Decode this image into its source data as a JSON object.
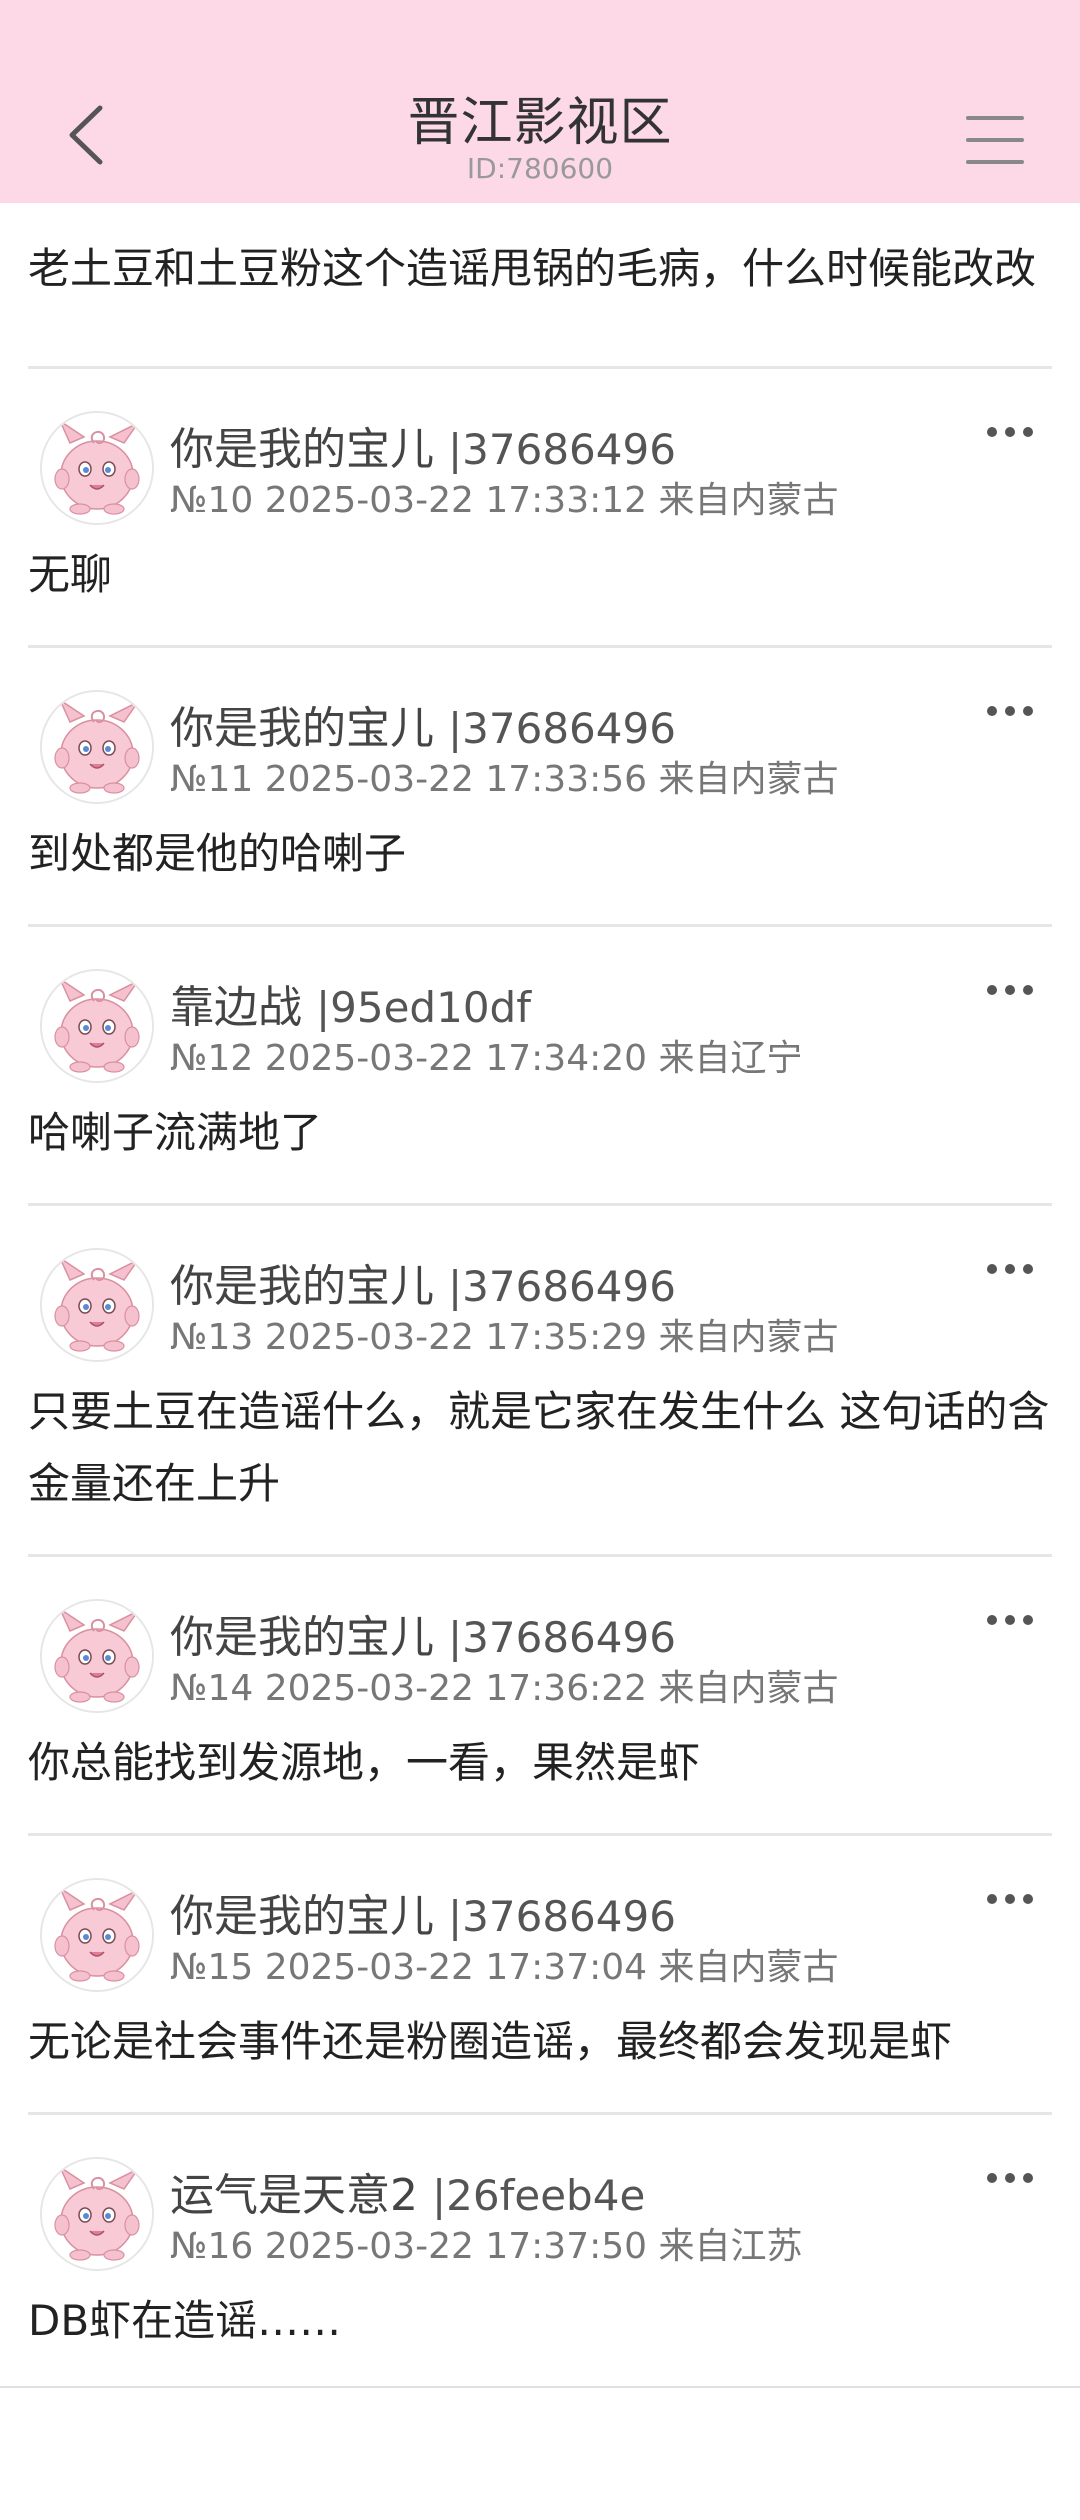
{
  "header": {
    "title": "晋江影视区",
    "subtitle": "ID:780600"
  },
  "top_post": {
    "body": "老土豆和土豆粉这个造谣甩锅的毛病，什么时候能改改"
  },
  "posts": [
    {
      "username": "你是我的宝儿",
      "uid": "|37686496",
      "meta": "№10 2025-03-22 17:33:12 来自内蒙古",
      "body": "无聊"
    },
    {
      "username": "你是我的宝儿",
      "uid": "|37686496",
      "meta": "№11 2025-03-22 17:33:56 来自内蒙古",
      "body": "到处都是他的哈喇子"
    },
    {
      "username": "靠边战",
      "uid": "|95ed10df",
      "meta": "№12 2025-03-22 17:34:20 来自辽宁",
      "body": "哈喇子流满地了"
    },
    {
      "username": "你是我的宝儿",
      "uid": "|37686496",
      "meta": "№13 2025-03-22 17:35:29 来自内蒙古",
      "body": "只要土豆在造谣什么，就是它家在发生什么 这句话的含金量还在上升"
    },
    {
      "username": "你是我的宝儿",
      "uid": "|37686496",
      "meta": "№14 2025-03-22 17:36:22 来自内蒙古",
      "body": "你总能找到发源地，一看，果然是虾"
    },
    {
      "username": "你是我的宝儿",
      "uid": "|37686496",
      "meta": "№15 2025-03-22 17:37:04 来自内蒙古",
      "body": "无论是社会事件还是粉圈造谣，最终都会发现是虾"
    },
    {
      "username": "运气是天意2",
      "uid": "|26feeb4e",
      "meta": "№16 2025-03-22 17:37:50 来自江苏",
      "body": "DB虾在造谣……"
    }
  ],
  "icons": {
    "back": "chevron-left-icon",
    "menu": "hamburger-menu-icon",
    "more": "more-dots-icon",
    "avatar": "pink-creature-avatar"
  },
  "colors": {
    "header_bg": "#fdd9e8",
    "text": "#222222",
    "meta": "#777777",
    "divider": "#e6e6e6"
  }
}
